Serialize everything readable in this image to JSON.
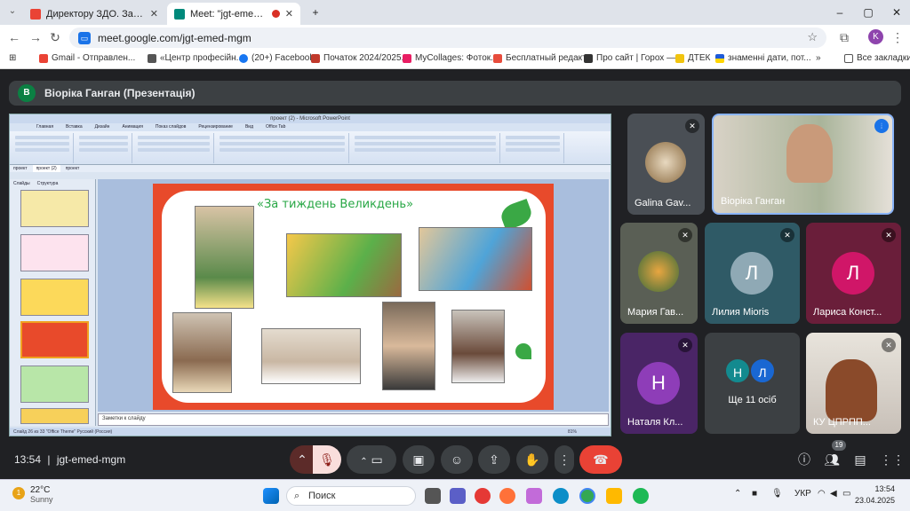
{
  "browser": {
    "tabs": [
      {
        "title": "Директору ЗДО. Запрошення",
        "active": false
      },
      {
        "title": "Meet: \"jgt-emed-mgm\"",
        "active": true
      }
    ],
    "new_tab": "+",
    "url": "meet.google.com/jgt-emed-mgm",
    "profile_initial": "K",
    "bookmarks": [
      "Gmail - Отправлен...",
      "«Центр професійн...",
      "(20+) Facebook",
      "Початок 2024/2025...",
      "MyCollages: Фоток...",
      "Бесплатный редакт...",
      "Про сайт | Горох —...",
      "ДТЕК",
      "знаменні дати, пот..."
    ],
    "all_bookmarks": "Все закладки"
  },
  "presentation": {
    "avatar_letter": "В",
    "title": "Віоріка Ганган (Презентація)"
  },
  "ppt": {
    "window_title": "проект (2) - Microsoft PowerPoint",
    "menu": [
      "Главная",
      "Вставка",
      "Дизайн",
      "Анимация",
      "Показ слайдов",
      "Рецензирование",
      "Вид",
      "Office Tab"
    ],
    "doc_tabs": [
      "проект",
      "проект (2)",
      "проект"
    ],
    "pane_tabs": [
      "Слайды",
      "Структура"
    ],
    "slide_title": "«За тиждень Великдень»",
    "notes": "Заметки к слайду",
    "status": "Слайд 26 из 33   \"Office Theme\"   Русский (Россия)",
    "zoom": "81%"
  },
  "participants": [
    {
      "name": "Galina Gav...",
      "muted": true
    },
    {
      "name": "Віоріка Ганган",
      "muted": false
    },
    {
      "name": "Мария Гав...",
      "muted": true
    },
    {
      "name": "Лилия Mioris",
      "initial": "Л",
      "muted": true
    },
    {
      "name": "Лариса Конст...",
      "initial": "Л",
      "muted": true
    },
    {
      "name": "Натaля Кл...",
      "initial": "Н",
      "muted": true
    },
    {
      "name": "Ще 11 осіб",
      "initials": [
        "Н",
        "Л"
      ]
    },
    {
      "name": "КУ ЦПРПП...",
      "muted": true
    }
  ],
  "controls": {
    "time": "13:54",
    "meeting_code": "jgt-emed-mgm",
    "people_count": "19"
  },
  "taskbar": {
    "weather_badge": "1",
    "temp": "22°C",
    "condition": "Sunny",
    "search": "Поиск",
    "lang": "УКР",
    "clock": "13:54",
    "date": "23.04.2025"
  },
  "colors": {
    "meet_bg": "#202124",
    "end_call": "#e94235",
    "slide_border": "#e84a2b"
  }
}
